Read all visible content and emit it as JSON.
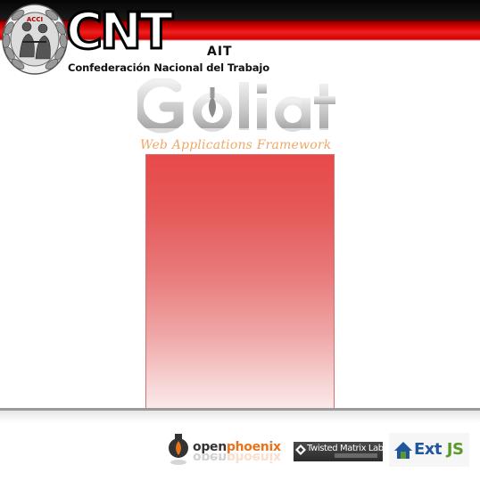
{
  "header": {
    "logo_text": "CNT",
    "logo_suffix": "AIT",
    "org_name": "Confederación Nacional del Trabajo"
  },
  "product": {
    "name": "Goliat",
    "tagline": "Web Applications Framework"
  },
  "footer": {
    "sponsors": [
      {
        "part1": "open",
        "part2": "phoenix"
      },
      {
        "label": "Twisted Matrix Labs"
      },
      {
        "part1": "Ext",
        "part2": "JS"
      }
    ]
  },
  "colors": {
    "header_red": "#d40000",
    "panel_top": "#e84a4a",
    "tagline": "#f0a868",
    "openphoenix_orange": "#e8731c",
    "extjs_blue": "#2255a0",
    "extjs_green": "#5a9a2a"
  },
  "icons": {
    "emblem": "cnt-emblem-icon",
    "openphoenix": "phoenix-bulb-icon",
    "twisted": "diamond-icon",
    "extjs": "extjs-house-icon"
  }
}
